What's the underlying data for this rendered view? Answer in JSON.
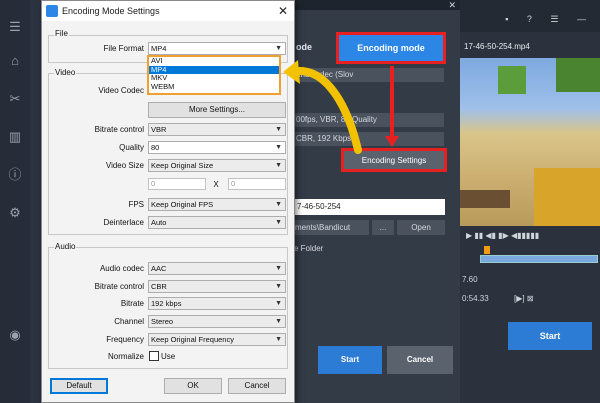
{
  "dialog": {
    "title": "Encoding Mode Settings",
    "close": "✕",
    "file_group": "File",
    "file_format_label": "File Format",
    "file_format_value": "MP4",
    "format_options": [
      "AVI",
      "MP4",
      "MKV",
      "WEBM"
    ],
    "selected_format_index": 1,
    "video_group": "Video",
    "video_codec_label": "Video Codec",
    "more_settings": "More Settings...",
    "bitrate_control_label": "Bitrate control",
    "bitrate_control_value": "VBR",
    "quality_label": "Quality",
    "quality_value": "80",
    "video_size_label": "Video Size",
    "video_size_value": "Keep Original Size",
    "size_w": "0",
    "size_x": "X",
    "size_h": "0",
    "fps_label": "FPS",
    "fps_value": "Keep Original FPS",
    "deinterlace_label": "Deinterlace",
    "deinterlace_value": "Auto",
    "audio_group": "Audio",
    "audio_codec_label": "Audio codec",
    "audio_codec_value": "AAC",
    "audio_bitrate_control_label": "Bitrate control",
    "audio_bitrate_control_value": "CBR",
    "audio_bitrate_label": "Bitrate",
    "audio_bitrate_value": "192 kbps",
    "channel_label": "Channel",
    "channel_value": "Stereo",
    "frequency_label": "Frequency",
    "frequency_value": "Keep Original Frequency",
    "normalize_label": "Normalize",
    "normalize_use": "Use",
    "default_btn": "Default",
    "ok_btn": "OK",
    "cancel_btn": "Cancel"
  },
  "middle": {
    "close": "✕",
    "mode_label": "ode",
    "encoding_mode_btn": "Encoding mode",
    "row1": "and codec (Slov",
    "row2": "00fps, VBR, 80 Quality",
    "row3": "CBR, 192 Kbps",
    "encoding_settings_btn": "Encoding Settings",
    "filename": "7-46-50-254",
    "dir": "ments\\Bandicut",
    "dots": "...",
    "open": "Open",
    "folder_label": "e Folder",
    "start": "Start",
    "cancel": "Cancel"
  },
  "right": {
    "top_icons": "▪ ? ☰ —",
    "file": "17-46-50-254.mp4",
    "controls": "▶ ▮▮ ◀▮ ▮▶  ◀▮▮▮▮▮",
    "time1": "7.60",
    "time2": "0:54.33",
    "ctrl2": "[▶]  ⊠",
    "start": "Start"
  },
  "colors": {
    "accent_blue": "#2c86e6",
    "highlight_red": "#e8201f",
    "arrow_yellow": "#f2c200",
    "dropdown_orange": "#f0a030"
  }
}
